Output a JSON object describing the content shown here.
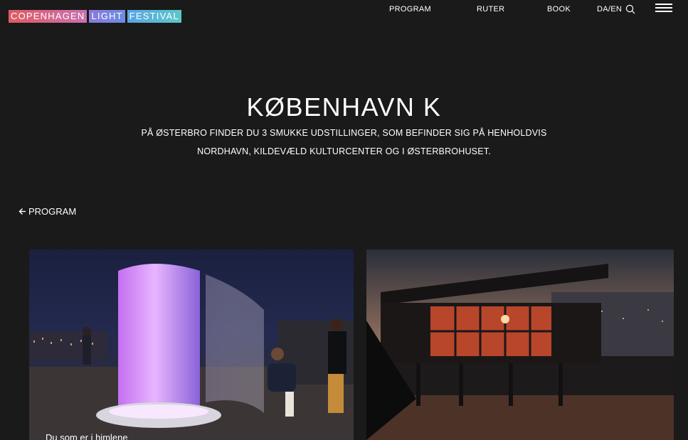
{
  "header": {
    "logo": [
      "COPENHAGEN",
      "LIGHT",
      "FESTIVAL"
    ],
    "nav": [
      "PROGRAM",
      "RUTER",
      "BOOK",
      "DA/EN"
    ]
  },
  "main": {
    "title": "KØBENHAVN K",
    "intro_line1": "PÅ ØSTERBRO FINDER DU 3 SMUKKE UDSTILLINGER, SOM BEFINDER SIG PÅ HENHOLDVIS",
    "intro_line2": "NORDHAVN, KILDEVÆLD KULTURCENTER OG I ØSTERBROHUSET.",
    "back_label": "PROGRAM"
  },
  "cards": [
    {
      "caption": "Du som er i himlene"
    },
    {
      "caption": ""
    }
  ],
  "colors": {
    "background": "#1a1a1a",
    "text": "#ffffff"
  }
}
